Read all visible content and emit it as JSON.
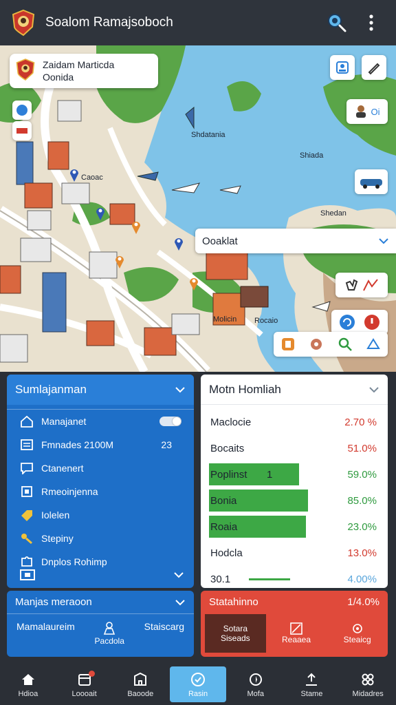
{
  "app": {
    "title": "Soalom Ramajsoboch",
    "icons": {
      "logo": "crest-logo",
      "search": "search-icon",
      "menu": "more-vert-icon"
    }
  },
  "map": {
    "location_card": {
      "line1": "Zaidam Marticda",
      "line2": "Oonida"
    },
    "labels": {
      "shdatania": "Shdatania",
      "shiada": "Shiada",
      "shedan": "Shedan",
      "caoac": "Caoac",
      "molicin": "Molicin",
      "rocaio": "Rocaio"
    },
    "side_badge": "Oi",
    "overlay_dropdown": {
      "value": "Ooaklat"
    },
    "tool_icons": [
      "podcast-icon",
      "settings-icon",
      "search-icon",
      "share-icon"
    ],
    "colors": {
      "water": "#7fc3e8",
      "land": "#e9e1cf",
      "park": "#4f9b3f",
      "roof": "#d9673f"
    }
  },
  "left_panel": {
    "title": "Sumlajanman",
    "items": [
      {
        "label": "Manajanet",
        "icon": "home-icon",
        "control": "toggle"
      },
      {
        "label": "Fmnades 2100M",
        "icon": "list-icon",
        "value": "23"
      },
      {
        "label": "Ctanenert",
        "icon": "chat-icon"
      },
      {
        "label": "Rmeoinjenna",
        "icon": "document-icon"
      },
      {
        "label": "Iolelen",
        "icon": "tag-icon"
      },
      {
        "label": "Stepiny",
        "icon": "key-icon"
      },
      {
        "label": "Dnplos Rohimp",
        "icon": "puzzle-icon"
      }
    ]
  },
  "right_panel": {
    "title": "Motn Homliah",
    "rows": [
      {
        "name": "Maclocie",
        "value": "2.70 %",
        "color": "#d23a2e",
        "bar": 0
      },
      {
        "name": "Bocaits",
        "value": "51.0%",
        "color": "#d23a2e",
        "bar": 0
      },
      {
        "name": "Poplinst",
        "extra": "1",
        "value": "59.0%",
        "color": "#2e9a3e",
        "bar": 0.5
      },
      {
        "name": "Bonia",
        "value": "85.0%",
        "color": "#2e9a3e",
        "bar": 0.55
      },
      {
        "name": "Roaia",
        "value": "23.0%",
        "color": "#2e9a3e",
        "bar": 0.54
      },
      {
        "name": "Hodcla",
        "value": "13.0%",
        "color": "#d23a2e",
        "bar": 0
      },
      {
        "name": "30.1",
        "value": "4.00%",
        "color": "#5aa6dc",
        "bar": 0
      }
    ]
  },
  "bottom_left_panel": {
    "title": "Manjas meraoon",
    "left_label": "Mamalaureim",
    "center_label": "Pacdola",
    "right_label": "Staiscarg"
  },
  "bottom_right_panel": {
    "title": "Statahinno",
    "value": "1/4.0%",
    "tabs": [
      {
        "line1": "Sotara",
        "line2": "Siseads",
        "active": true
      },
      {
        "line1": "Reaaea",
        "line2": "",
        "icon": "image-icon"
      },
      {
        "line1": "Steaicg",
        "line2": "",
        "icon": "gear-icon"
      }
    ]
  },
  "nav": {
    "items": [
      {
        "label": "Hdioa",
        "icon": "home-icon"
      },
      {
        "label": "Loooait",
        "icon": "calendar-icon",
        "badge": true
      },
      {
        "label": "Baoode",
        "icon": "building-icon"
      },
      {
        "label": "Rasin",
        "icon": "chat-bubble-icon",
        "active": true
      },
      {
        "label": "Mofa",
        "icon": "compass-icon"
      },
      {
        "label": "Stame",
        "icon": "upload-icon"
      },
      {
        "label": "Midadres",
        "icon": "grid-icon"
      }
    ]
  }
}
